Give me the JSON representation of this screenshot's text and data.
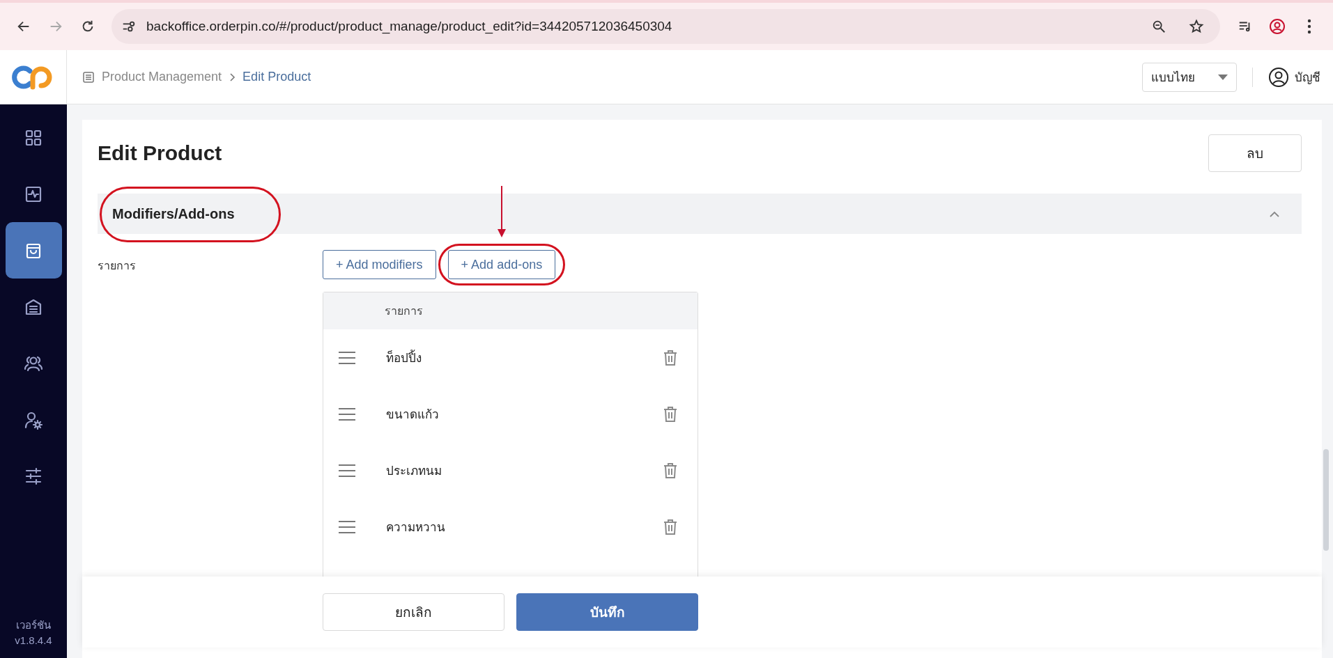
{
  "browser": {
    "url": "backoffice.orderpin.co/#/product/product_manage/product_edit?id=344205712036450304",
    "forward_disabled": true
  },
  "header": {
    "breadcrumb": [
      {
        "label": "Product Management",
        "selected": false
      },
      {
        "label": "Edit Product",
        "selected": true
      }
    ],
    "language": "แบบไทย",
    "account": "บัญชี"
  },
  "sidebar": {
    "items": [
      {
        "selected": false
      },
      {
        "selected": false
      },
      {
        "selected": true
      },
      {
        "selected": false
      },
      {
        "selected": false
      },
      {
        "selected": false
      },
      {
        "selected": false
      }
    ],
    "version_label": "เวอร์ชัน",
    "version": "v1.8.4.4"
  },
  "page": {
    "title": "Edit Product",
    "delete_button": "ลบ",
    "section": {
      "title": "Modifiers/Add-ons",
      "highlighted": true,
      "expanded": true,
      "field_label": "รายการ",
      "buttons": [
        {
          "label": "+ Add modifiers",
          "highlighted": false
        },
        {
          "label": "+ Add add-ons",
          "highlighted": true
        }
      ],
      "table": {
        "columns": [
          "รายการ"
        ],
        "rows": [
          {
            "name": "ท็อปปิ้ง"
          },
          {
            "name": "ขนาดแก้ว"
          },
          {
            "name": "ประเภทนม"
          },
          {
            "name": "ความหวาน"
          }
        ]
      }
    },
    "footer": {
      "cancel": "ยกเลิก",
      "save": "บันทึก"
    }
  }
}
